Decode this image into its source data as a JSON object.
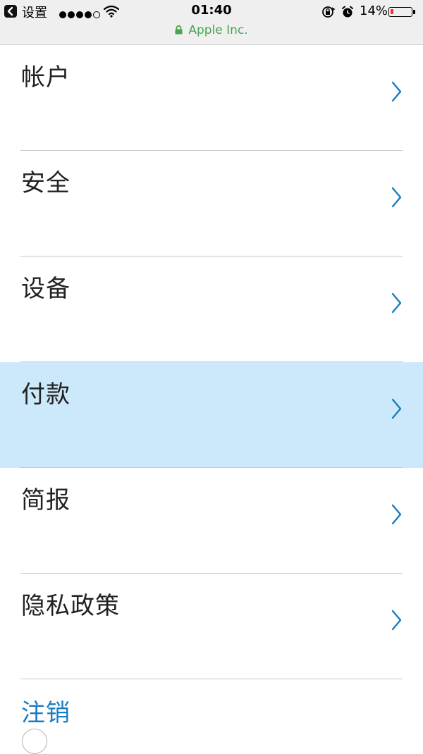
{
  "status_bar": {
    "back_label": "设置",
    "time": "01:40",
    "battery_percent": "14%",
    "battery_level": 0.14,
    "signal_bars_filled": 4,
    "signal_bars_total": 5
  },
  "browser": {
    "site_name": "Apple Inc."
  },
  "menu": {
    "items": [
      {
        "label": "帐户"
      },
      {
        "label": "安全"
      },
      {
        "label": "设备"
      },
      {
        "label": "付款"
      },
      {
        "label": "简报"
      },
      {
        "label": "隐私政策"
      }
    ],
    "logout_label": "注销"
  },
  "colors": {
    "accent": "#1a7bbf",
    "highlight": "#cce9fb",
    "secure": "#4aa552",
    "battery_low": "#ff2d2d"
  },
  "icons": {
    "back": "back-chevron-icon",
    "wifi": "wifi-icon",
    "rotation_lock": "rotation-lock-icon",
    "alarm": "alarm-clock-icon",
    "padlock": "padlock-icon",
    "row_chevron": "chevron-right-icon"
  }
}
